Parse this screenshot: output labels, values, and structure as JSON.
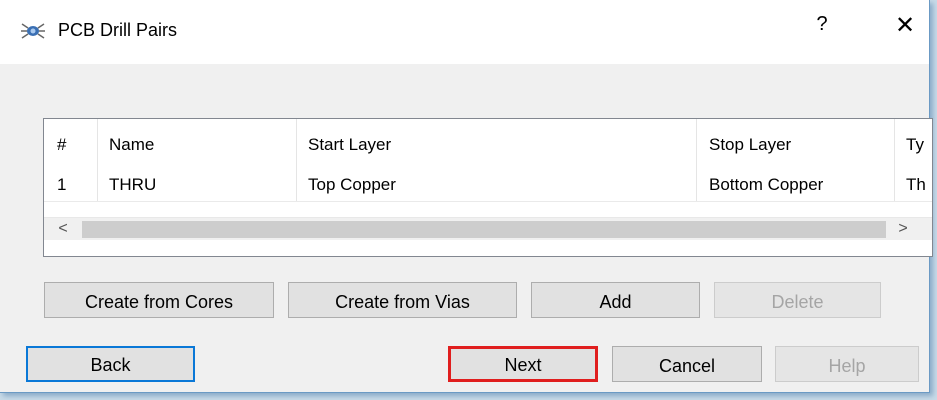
{
  "window": {
    "title": "PCB Drill Pairs",
    "help_glyph": "?",
    "close_glyph": "✕",
    "app_icon": "pcb-bug-icon"
  },
  "list": {
    "columns": [
      "#",
      "Name",
      "Start Layer",
      "Stop Layer",
      "Ty"
    ],
    "rows": [
      [
        "1",
        "THRU",
        "Top Copper",
        "Bottom Copper",
        "Th"
      ]
    ],
    "scroll_left_glyph": "<",
    "scroll_right_glyph": ">"
  },
  "actions": {
    "create_from_cores": "Create from Cores",
    "create_from_vias": "Create from Vias",
    "add": "Add",
    "delete": "Delete"
  },
  "nav": {
    "back": "Back",
    "next": "Next",
    "cancel": "Cancel",
    "help": "Help"
  },
  "colors": {
    "focus_border": "#0a78d7",
    "highlight_border": "#e01e1e"
  }
}
